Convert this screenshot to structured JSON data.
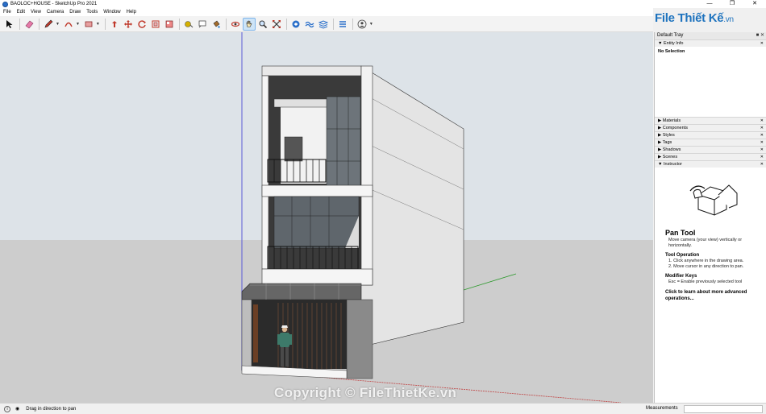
{
  "window": {
    "title": "BAOLOC+HOUSE - SketchUp Pro 2021"
  },
  "menu": [
    "File",
    "Edit",
    "View",
    "Camera",
    "Draw",
    "Tools",
    "Window",
    "Help"
  ],
  "toolbar": {
    "tools": [
      "select",
      "eraser",
      "pencil",
      "arc",
      "shape",
      "push-pull",
      "move",
      "rotate",
      "offset",
      "scale",
      "tape-measure",
      "text",
      "paint-bucket",
      "orbit",
      "pan",
      "zoom",
      "zoom-extents",
      "components",
      "sandbox",
      "photo-textures",
      "layers",
      "account"
    ],
    "active_tool": "pan"
  },
  "logo": {
    "brand": "File Thiết Kế",
    "suffix": ".vn"
  },
  "tray": {
    "title": "Default Tray",
    "entity_info": {
      "label": "Entity Info",
      "selection": "No Selection"
    },
    "panels": [
      "Materials",
      "Components",
      "Styles",
      "Tags",
      "Shadows",
      "Scenes",
      "Instructor"
    ],
    "instructor": {
      "tool_name": "Pan Tool",
      "description": "Move camera (your view) vertically or horizontally.",
      "op_heading": "Tool Operation",
      "op_steps": [
        "1. Click anywhere in the drawing area.",
        "2. Move cursor in any direction to pan."
      ],
      "mod_heading": "Modifier Keys",
      "mod_text": "Esc = Enable previously selected tool",
      "more_link": "Click to learn about more advanced operations..."
    }
  },
  "status": {
    "message": "Drag in direction to pan",
    "measurements_label": "Measurements",
    "measurements_value": ""
  },
  "watermark": "Copyright © FileThietKe.vn",
  "colors": {
    "accent": "#1e73be",
    "sky": "#dfe5ea",
    "ground": "#cfcfcf",
    "active_tool_bg": "#cde4f7"
  }
}
